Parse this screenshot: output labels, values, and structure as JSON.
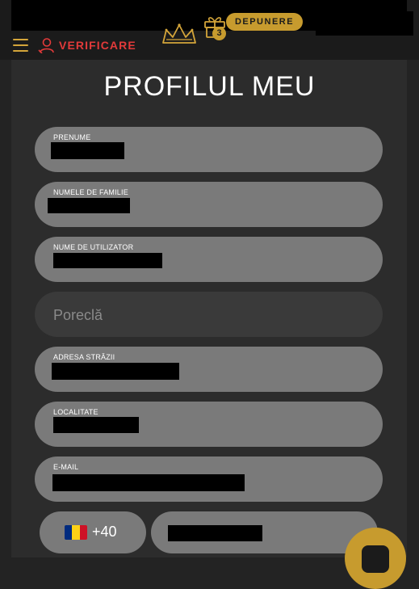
{
  "header": {
    "verify_label": "VERIFICARE",
    "deposit_label": "DEPUNERE",
    "gift_count": "3",
    "accent_color": "#c79b2e",
    "alert_color": "#e23a3a"
  },
  "page": {
    "title": "PROFILUL MEU"
  },
  "form": {
    "first_name_label": "PRENUME",
    "last_name_label": "NUMELE DE FAMILIE",
    "username_label": "NUME DE UTILIZATOR",
    "nickname_placeholder": "Poreclă",
    "street_label": "ADRESA STRĂZII",
    "city_label": "LOCALITATE",
    "email_label": "E-MAIL",
    "phone_code": "+40",
    "phone_flag_colors": [
      "#002b7f",
      "#fcd116",
      "#ce1126"
    ]
  }
}
